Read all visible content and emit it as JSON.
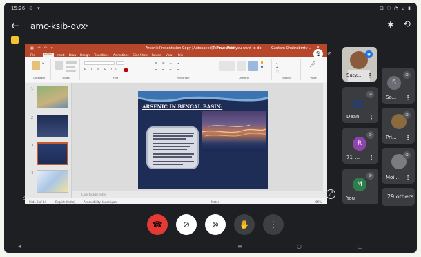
{
  "status_bar": {
    "time": "15:26",
    "left_icons": "⊙ ▾",
    "right_icons": "⊡ ☉ ◔ ⊿ ▮"
  },
  "meeting": {
    "code": "amc-ksib-qvx",
    "code_caret": "▸"
  },
  "presentation": {
    "app_title": "Arsenic Presentation Copy [Autosaved] - PowerPoint",
    "search_placeholder": "Tell me what you want to do",
    "user": "Gautam Chakraborty",
    "menu": [
      "File",
      "Home",
      "Insert",
      "Draw",
      "Design",
      "Transitions",
      "Animations",
      "Slide Show",
      "Review",
      "View",
      "Help"
    ],
    "ribbon_groups": [
      "Clipboard",
      "Slides",
      "Font",
      "Paragraph",
      "Drawing",
      "Editing",
      "Voice"
    ],
    "slide_numbers": [
      "1",
      "2",
      "3",
      "4"
    ],
    "selected_slide": 3,
    "notes_placeholder": "Click to add notes",
    "status": {
      "slide_count": "Slide 3 of 14",
      "language": "English (India)",
      "accessibility": "Accessibility: Investigate",
      "notes": "Notes",
      "zoom": "66%"
    },
    "slide": {
      "title": "ARSENIC IN BENGAL BASIN:"
    }
  },
  "self_view_label": "Sat...",
  "participants": [
    {
      "name": "Saty...",
      "kind": "video-self"
    },
    {
      "name": "So...",
      "kind": "avatar",
      "initial": "S",
      "color": "#6a6d73"
    },
    {
      "name": "Dean",
      "kind": "logo",
      "logo_text_1": "DEAN",
      "logo_text_2": "R&D"
    },
    {
      "name": "Pri...",
      "kind": "photo"
    },
    {
      "name": "71_...",
      "kind": "avatar",
      "initial": "R",
      "color": "#8e44ad"
    },
    {
      "name": "Moi...",
      "kind": "photo"
    },
    {
      "name": "You",
      "kind": "avatar",
      "initial": "M",
      "color": "#2e7d4f"
    },
    {
      "name": "29 others",
      "kind": "others"
    }
  ],
  "controls": [
    {
      "name": "end-call",
      "glyph": "☎",
      "color": "#e53935"
    },
    {
      "name": "camera-off",
      "glyph": "⊘",
      "color": "#ffffff"
    },
    {
      "name": "mic-off",
      "glyph": "⊗",
      "color": "#ffffff"
    },
    {
      "name": "raise-hand",
      "glyph": "✋",
      "color": "#3c4043"
    },
    {
      "name": "more-options",
      "glyph": "⋮",
      "color": "#3c4043"
    }
  ],
  "nav": {
    "back": "◂",
    "home": "○",
    "recents": "□",
    "menu": "≡"
  }
}
